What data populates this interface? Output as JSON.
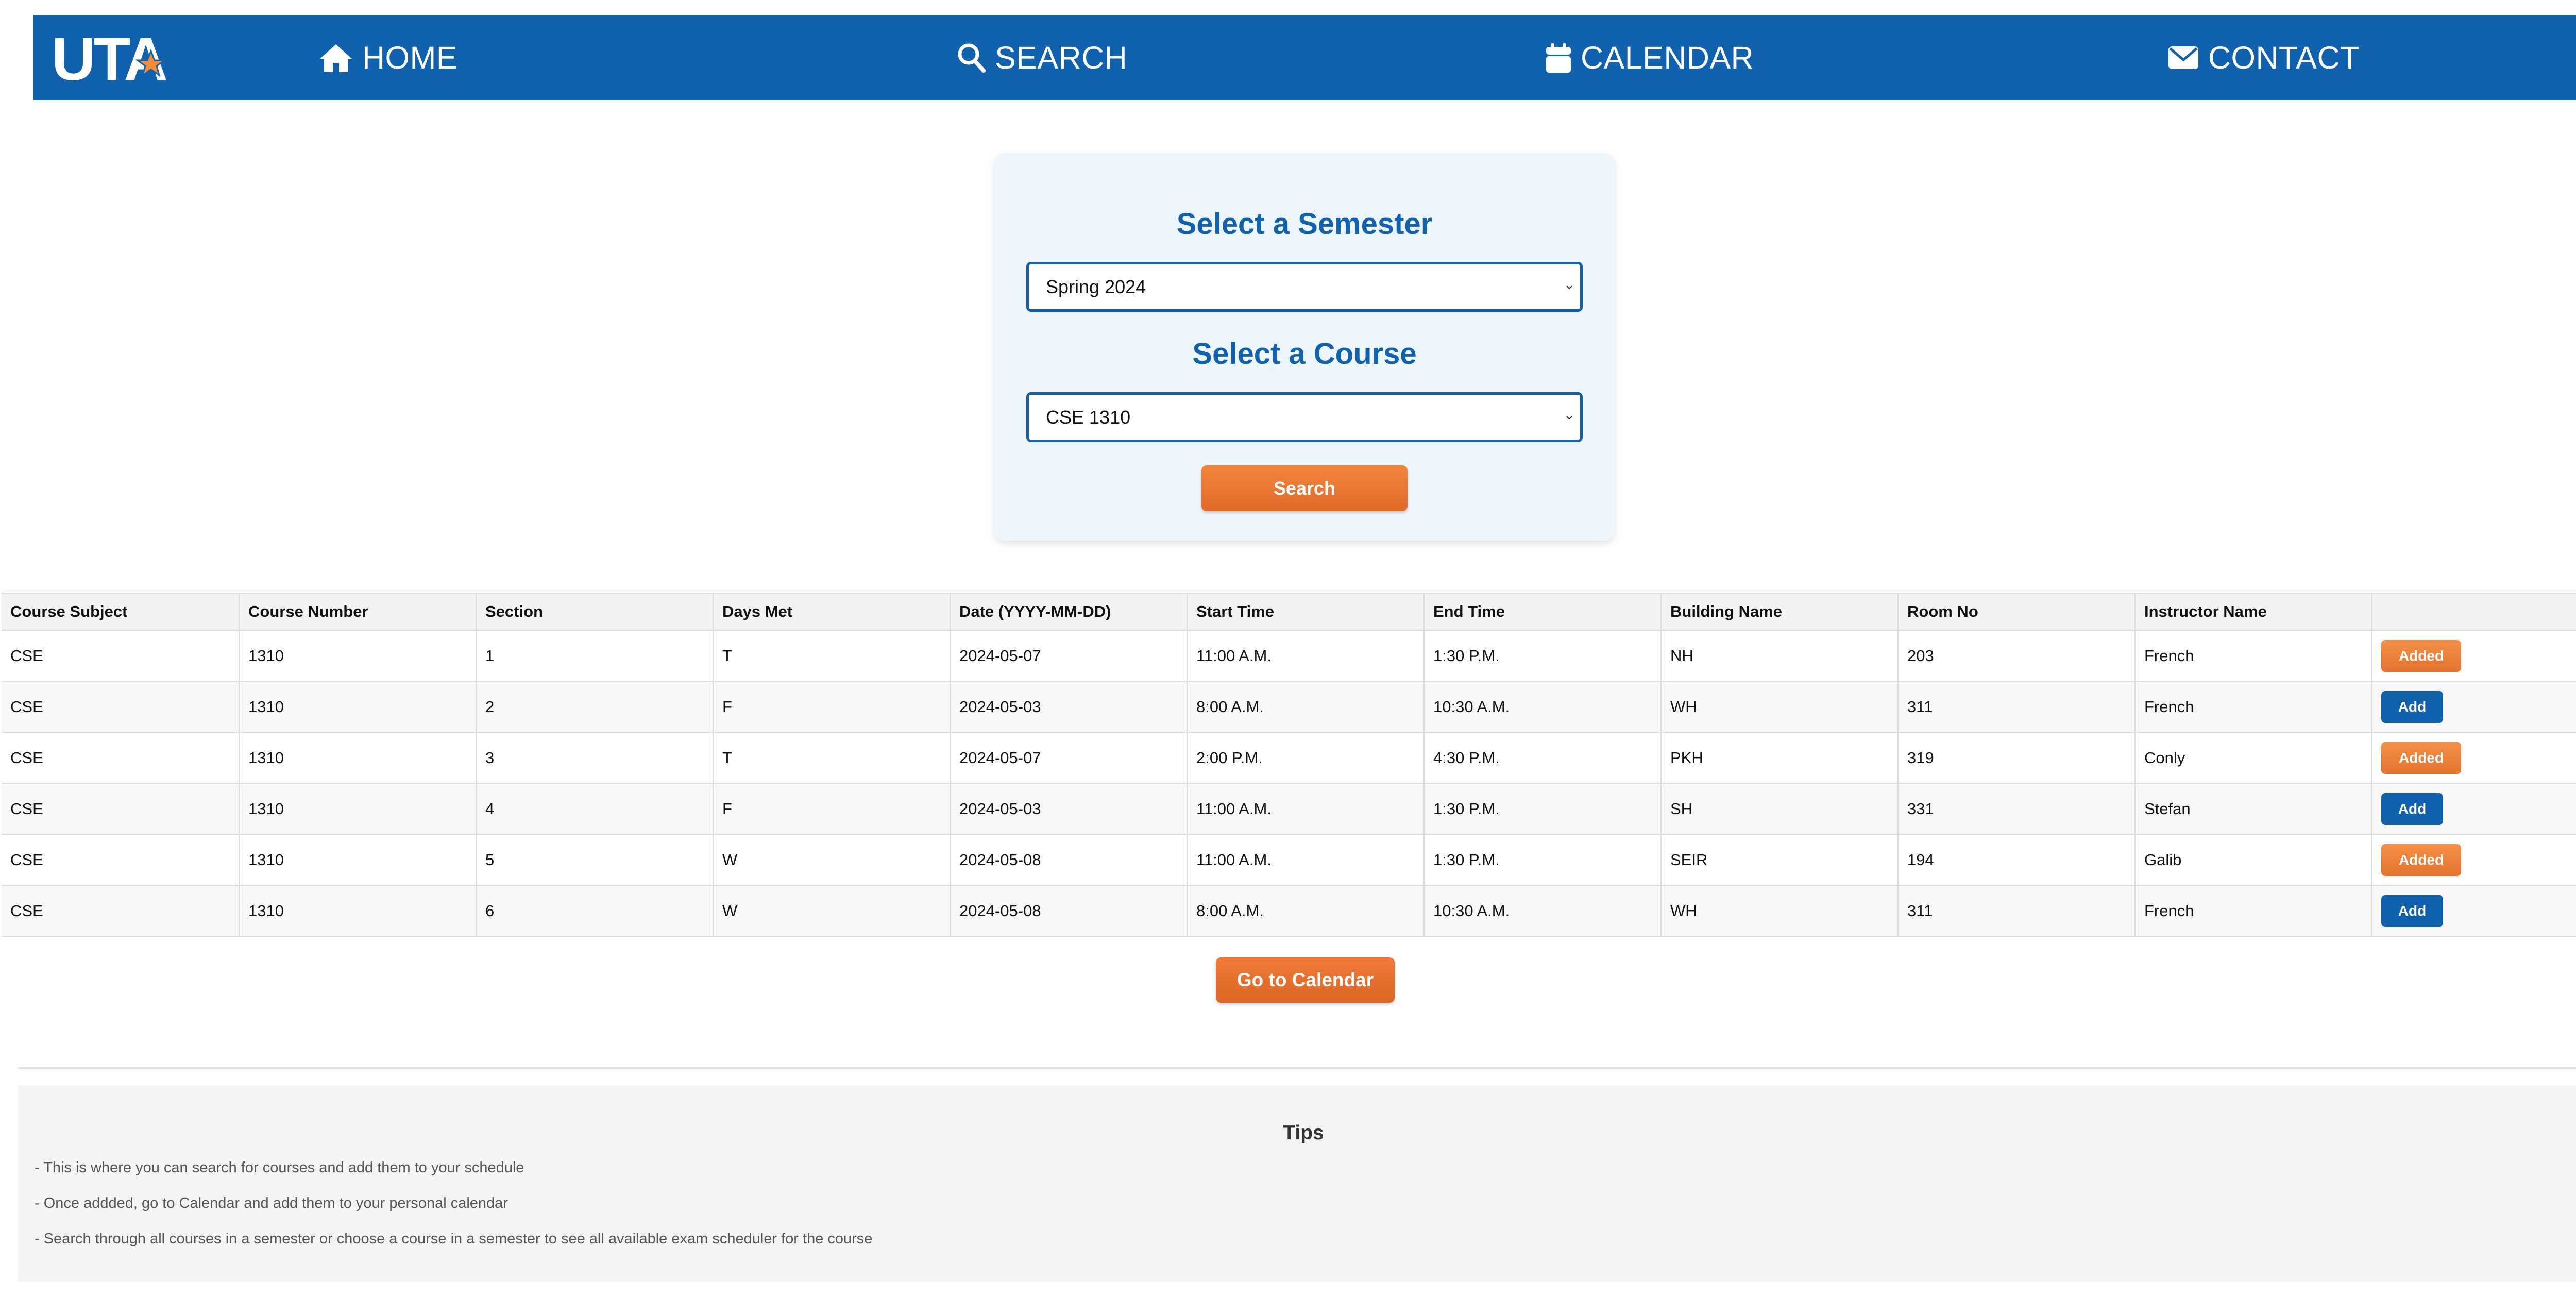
{
  "nav": {
    "logo_text": "UTA",
    "items": [
      {
        "label": "HOME",
        "icon": "home-icon"
      },
      {
        "label": "SEARCH",
        "icon": "search-icon"
      },
      {
        "label": "CALENDAR",
        "icon": "calendar-icon"
      },
      {
        "label": "CONTACT",
        "icon": "envelope-icon"
      }
    ],
    "bg_color": "#1162ae"
  },
  "search_card": {
    "semester_heading": "Select a Semester",
    "semester_value": "Spring 2024",
    "course_heading": "Select a Course",
    "course_value": "CSE 1310",
    "search_button": "Search"
  },
  "table": {
    "headers": [
      "Course Subject",
      "Course Number",
      "Section",
      "Days Met",
      "Date (YYYY-MM-DD)",
      "Start Time",
      "End Time",
      "Building Name",
      "Room No",
      "Instructor Name",
      ""
    ],
    "rows": [
      {
        "cells": [
          "CSE",
          "1310",
          "1",
          "T",
          "2024-05-07",
          "11:00 A.M.",
          "1:30 P.M.",
          "NH",
          "203",
          "French"
        ],
        "action": "Added"
      },
      {
        "cells": [
          "CSE",
          "1310",
          "2",
          "F",
          "2024-05-03",
          "8:00 A.M.",
          "10:30 A.M.",
          "WH",
          "311",
          "French"
        ],
        "action": "Add"
      },
      {
        "cells": [
          "CSE",
          "1310",
          "3",
          "T",
          "2024-05-07",
          "2:00 P.M.",
          "4:30 P.M.",
          "PKH",
          "319",
          "Conly"
        ],
        "action": "Added"
      },
      {
        "cells": [
          "CSE",
          "1310",
          "4",
          "F",
          "2024-05-03",
          "11:00 A.M.",
          "1:30 P.M.",
          "SH",
          "331",
          "Stefan"
        ],
        "action": "Add"
      },
      {
        "cells": [
          "CSE",
          "1310",
          "5",
          "W",
          "2024-05-08",
          "11:00 A.M.",
          "1:30 P.M.",
          "SEIR",
          "194",
          "Galib"
        ],
        "action": "Added"
      },
      {
        "cells": [
          "CSE",
          "1310",
          "6",
          "W",
          "2024-05-08",
          "8:00 A.M.",
          "10:30 A.M.",
          "WH",
          "311",
          "French"
        ],
        "action": "Add"
      }
    ]
  },
  "go_calendar_button": "Go to Calendar",
  "tips": {
    "title": "Tips",
    "lines": [
      "- This is where you can search for courses and add them to your schedule",
      "- Once addded, go to Calendar and add them to your personal calendar",
      "- Search through all courses in a semester or choose a course in a semester to see all available exam scheduler for the course"
    ]
  },
  "colors": {
    "primary_blue": "#1162ae",
    "accent_orange": "#e8772f",
    "card_bg": "#eef6fd"
  }
}
